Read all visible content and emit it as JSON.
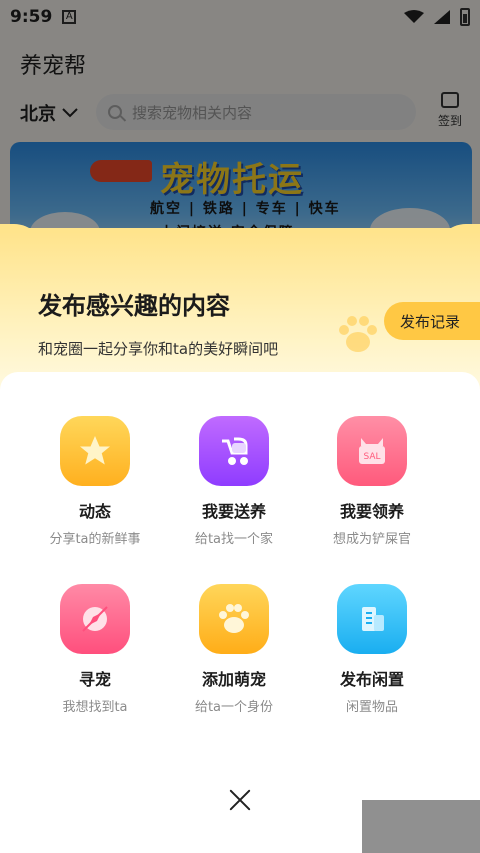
{
  "status_bar": {
    "time": "9:59",
    "notification_icon": "A"
  },
  "app": {
    "title": "养宠帮",
    "location": "北京",
    "search_placeholder": "搜索宠物相关内容",
    "checkin_label": "签到"
  },
  "banner": {
    "title": "宠物托运",
    "line1": "航空 | 铁路 | 专车 | 快车",
    "line2": "上门接送 安全保障"
  },
  "sheet": {
    "title": "发布感兴趣的内容",
    "subtitle": "和宠圈一起分享你和ta的美好瞬间吧",
    "publish_record": "发布记录",
    "items": [
      {
        "label": "动态",
        "desc": "分享ta的新鲜事",
        "icon": "star-icon",
        "color": "#ffc53a"
      },
      {
        "label": "我要送养",
        "desc": "给ta找一个家",
        "icon": "stroller-icon",
        "color": "#a257ff"
      },
      {
        "label": "我要领养",
        "desc": "想成为铲屎官",
        "icon": "sale-box-icon",
        "color": "#ff6b8a",
        "icon_text": "SAL"
      },
      {
        "label": "寻宠",
        "desc": "我想找到ta",
        "icon": "compass-icon",
        "color": "#ff5f8a"
      },
      {
        "label": "添加萌宠",
        "desc": "给ta一个身份",
        "icon": "paw-icon",
        "color": "#ffbe2e"
      },
      {
        "label": "发布闲置",
        "desc": "闲置物品",
        "icon": "building-icon",
        "color": "#2ec5ff"
      }
    ]
  }
}
